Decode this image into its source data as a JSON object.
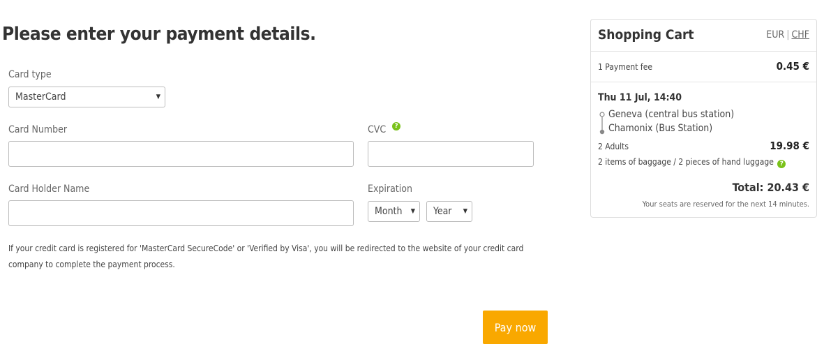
{
  "page_title": "Please enter your payment details.",
  "form": {
    "card_type_label": "Card type",
    "card_type_value": "MasterCard",
    "card_number_label": "Card Number",
    "card_number_value": "",
    "cvc_label": "CVC",
    "cvc_value": "",
    "card_holder_label": "Card Holder Name",
    "card_holder_value": "",
    "expiration_label": "Expiration",
    "month_value": "Month",
    "year_value": "Year",
    "help_glyph": "?",
    "note": "If your credit card is registered for 'MasterCard SecureCode' or 'Verified by Visa', you will be redirected to the website of your credit card company to complete the payment process.",
    "pay_label": "Pay now"
  },
  "cart": {
    "title": "Shopping Cart",
    "currency_eur": "EUR",
    "currency_separator": "|",
    "currency_chf": "CHF",
    "fee_label": "1 Payment fee",
    "fee_value": "0.45 €",
    "trip_date": "Thu 11 Jul, 14:40",
    "from": "Geneva (central bus station)",
    "to": "Chamonix (Bus Station)",
    "passengers": "2 Adults",
    "passengers_price": "19.98 €",
    "baggage": "2 items of baggage / 2 pieces of hand luggage",
    "total": "Total: 20.43 €",
    "reserved_note": "Your seats are reserved for the next 14 minutes."
  },
  "colors": {
    "pay_button": "#f9a800",
    "help_icon": "#7ac21a"
  },
  "icons": [
    "help-icon",
    "dropdown-arrow-icon",
    "route-line-icon"
  ]
}
